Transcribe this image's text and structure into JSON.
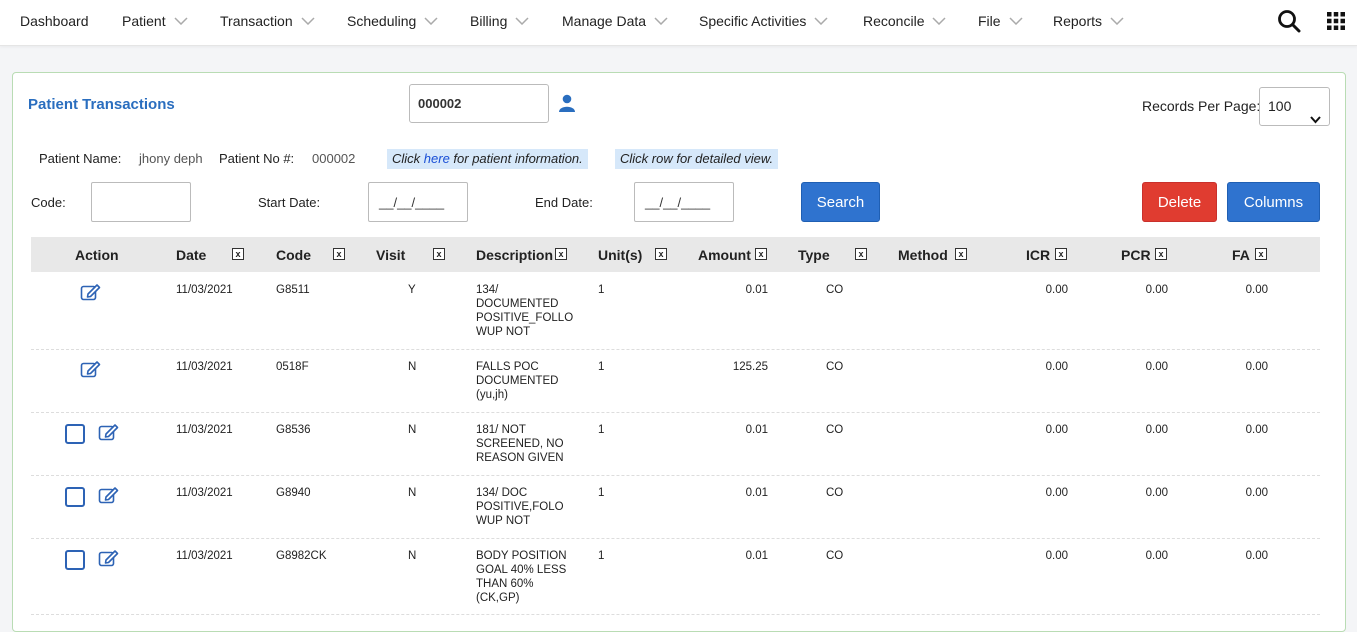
{
  "nav": {
    "items": [
      {
        "label": "Dashboard",
        "dropdown": false
      },
      {
        "label": "Patient",
        "dropdown": true
      },
      {
        "label": "Transaction",
        "dropdown": true
      },
      {
        "label": "Scheduling",
        "dropdown": true
      },
      {
        "label": "Billing",
        "dropdown": true
      },
      {
        "label": "Manage Data",
        "dropdown": true
      },
      {
        "label": "Specific Activities",
        "dropdown": true
      },
      {
        "label": "Reconcile",
        "dropdown": true
      },
      {
        "label": "File",
        "dropdown": true
      },
      {
        "label": "Reports",
        "dropdown": true
      }
    ]
  },
  "page": {
    "title": "Patient Transactions",
    "patient_input_value": "000002",
    "records_per_page_label": "Records Per Page:",
    "records_per_page_value": "100"
  },
  "patient_info": {
    "name_label": "Patient Name:",
    "name_value": "jhony deph",
    "no_label": "Patient No #:",
    "no_value": "000002",
    "hint1_pre": "Click ",
    "hint1_link": "here",
    "hint1_post": " for patient information.",
    "hint2": "Click row for detailed view."
  },
  "filters": {
    "code_label": "Code:",
    "code_value": "",
    "start_label": "Start Date:",
    "start_value": "__/__/____",
    "end_label": "End Date:",
    "end_value": "__/__/____",
    "search_label": "Search",
    "delete_label": "Delete",
    "columns_label": "Columns"
  },
  "table": {
    "columns": [
      "Action",
      "Date",
      "Code",
      "Visit",
      "Description",
      "Unit(s)",
      "Amount",
      "Type",
      "Method",
      "ICR",
      "PCR",
      "FA"
    ],
    "remove_mark": "x",
    "rows": [
      {
        "checkbox": false,
        "date": "11/03/2021",
        "code": "G8511",
        "visit": "Y",
        "description": "134/ DOCUMENTED POSITIVE_FOLLO WUP NOT",
        "units": "1",
        "amount": "0.01",
        "type": "CO",
        "method": "",
        "icr": "0.00",
        "pcr": "0.00",
        "fa": "0.00"
      },
      {
        "checkbox": false,
        "date": "11/03/2021",
        "code": "0518F",
        "visit": "N",
        "description": "FALLS POC DOCUMENTED (yu,jh)",
        "units": "1",
        "amount": "125.25",
        "type": "CO",
        "method": "",
        "icr": "0.00",
        "pcr": "0.00",
        "fa": "0.00"
      },
      {
        "checkbox": true,
        "date": "11/03/2021",
        "code": "G8536",
        "visit": "N",
        "description": "181/ NOT SCREENED, NO REASON GIVEN",
        "units": "1",
        "amount": "0.01",
        "type": "CO",
        "method": "",
        "icr": "0.00",
        "pcr": "0.00",
        "fa": "0.00"
      },
      {
        "checkbox": true,
        "date": "11/03/2021",
        "code": "G8940",
        "visit": "N",
        "description": "134/ DOC POSITIVE,FOLO WUP NOT",
        "units": "1",
        "amount": "0.01",
        "type": "CO",
        "method": "",
        "icr": "0.00",
        "pcr": "0.00",
        "fa": "0.00"
      },
      {
        "checkbox": true,
        "date": "11/03/2021",
        "code": "G8982CK",
        "visit": "N",
        "description": "BODY POSITION GOAL 40% LESS THAN 60% (CK,GP)",
        "units": "1",
        "amount": "0.01",
        "type": "CO",
        "method": "",
        "icr": "0.00",
        "pcr": "0.00",
        "fa": "0.00"
      }
    ]
  },
  "colors": {
    "accent": "#2f73cf",
    "danger": "#e03c30",
    "title": "#2a6ebf",
    "hint_bg": "#d6e8fa"
  },
  "icons": {
    "search": "search-icon",
    "apps": "grid-menu-icon",
    "user": "user-icon",
    "edit": "edit-icon"
  }
}
